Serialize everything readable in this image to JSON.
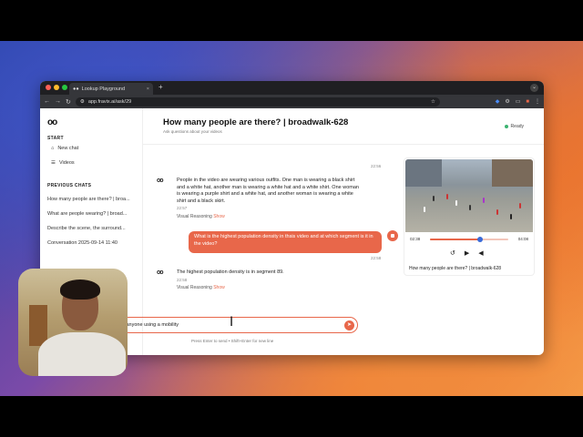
{
  "browser": {
    "tab_title": "Lookup Playground",
    "url": "app.fravix.ai/ask/29"
  },
  "sidebar": {
    "logo": "oo",
    "start_label": "START",
    "nav": [
      {
        "label": "New chat",
        "icon": "home-icon"
      },
      {
        "label": "Videos",
        "icon": "list-icon"
      }
    ],
    "previous_label": "PREVIOUS CHATS",
    "chats": [
      "How many people are there? | broa...",
      "What are people wearing? | broad...",
      "Describe the scene, the surround...",
      "Conversation 2025-09-14 11:40"
    ]
  },
  "header": {
    "title": "How many people are there? | broadwalk-628",
    "subtitle": "Ask questions about your videos",
    "status": "Ready",
    "status_color": "#3cb371"
  },
  "messages": {
    "top_ts": "22:56",
    "bot1_text": "People in the video are wearing various outfits. One man is wearing a black shirt and a white hat, another man is wearing a white hat and a white shirt. One woman is wearing a purple shirt and a white hat, and another woman is wearing a white shirt and a black skirt.",
    "bot1_ts": "22:57",
    "vr_label": "Visual Reasoning",
    "show_label": "Show",
    "user_text": "What is the highest population density in thsis video and at which segment is it in the video?",
    "user_ts": "22:58",
    "bot2_text": "The highest population density is in segment 89.",
    "bot2_ts": "22:58"
  },
  "input": {
    "value": "is anyone using a mobility",
    "hint": "Press Enter to send • Shift+Enter for new line"
  },
  "video": {
    "current": "02:38",
    "duration": "04:08",
    "progress": 0.64,
    "caption": "How many people are there? | broadwalk-628"
  },
  "colors": {
    "accent": "#e8674a"
  }
}
